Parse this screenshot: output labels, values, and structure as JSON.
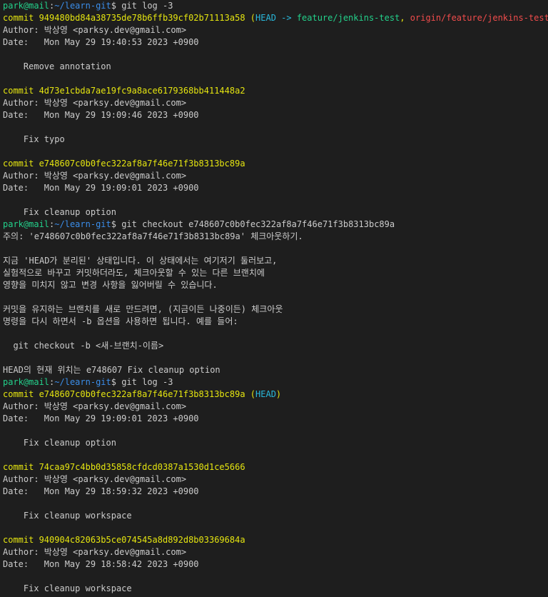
{
  "theme": {
    "background": "#1e1e1e",
    "foreground": "#cccccc",
    "prompt_user": "#23d18b",
    "prompt_path": "#3b8eea",
    "commit": "#e5e510",
    "ref_head": "#29b8db",
    "ref_branch": "#23d18b",
    "ref_remote": "#f14c4c"
  },
  "terminal": {
    "lines": [
      {
        "segments": [
          {
            "text": "park@mail",
            "cls": "prompt-user"
          },
          {
            "text": ":"
          },
          {
            "text": "~/learn-git",
            "cls": "prompt-path"
          },
          {
            "text": "$ git log -3"
          }
        ]
      },
      {
        "segments": [
          {
            "text": "commit 949480bd84a38735de78b6ffb39cf02b71113a58 (",
            "cls": "commit-yellow"
          },
          {
            "text": "HEAD -> ",
            "cls": "ref-head"
          },
          {
            "text": "feature/jenkins-test",
            "cls": "ref-branch"
          },
          {
            "text": ", ",
            "cls": "commit-yellow"
          },
          {
            "text": "origin/feature/jenkins-test",
            "cls": "ref-remote"
          },
          {
            "text": ")",
            "cls": "commit-yellow"
          }
        ]
      },
      {
        "segments": [
          {
            "text": "Author: 박상영 <parksy.dev@gmail.com>"
          }
        ]
      },
      {
        "segments": [
          {
            "text": "Date:   Mon May 29 19:40:53 2023 +0900"
          }
        ]
      },
      {
        "segments": [
          {
            "text": ""
          }
        ]
      },
      {
        "segments": [
          {
            "text": "    Remove annotation"
          }
        ]
      },
      {
        "segments": [
          {
            "text": ""
          }
        ]
      },
      {
        "segments": [
          {
            "text": "commit 4d73e1cbda7ae19fc9a8ace6179368bb411448a2",
            "cls": "commit-yellow"
          }
        ]
      },
      {
        "segments": [
          {
            "text": "Author: 박상영 <parksy.dev@gmail.com>"
          }
        ]
      },
      {
        "segments": [
          {
            "text": "Date:   Mon May 29 19:09:46 2023 +0900"
          }
        ]
      },
      {
        "segments": [
          {
            "text": ""
          }
        ]
      },
      {
        "segments": [
          {
            "text": "    Fix typo"
          }
        ]
      },
      {
        "segments": [
          {
            "text": ""
          }
        ]
      },
      {
        "segments": [
          {
            "text": "commit e748607c0b0fec322af8a7f46e71f3b8313bc89a",
            "cls": "commit-yellow"
          }
        ]
      },
      {
        "segments": [
          {
            "text": "Author: 박상영 <parksy.dev@gmail.com>"
          }
        ]
      },
      {
        "segments": [
          {
            "text": "Date:   Mon May 29 19:09:01 2023 +0900"
          }
        ]
      },
      {
        "segments": [
          {
            "text": ""
          }
        ]
      },
      {
        "segments": [
          {
            "text": "    Fix cleanup option"
          }
        ]
      },
      {
        "segments": [
          {
            "text": "park@mail",
            "cls": "prompt-user"
          },
          {
            "text": ":"
          },
          {
            "text": "~/learn-git",
            "cls": "prompt-path"
          },
          {
            "text": "$ git checkout e748607c0b0fec322af8a7f46e71f3b8313bc89a"
          }
        ]
      },
      {
        "segments": [
          {
            "text": "주의: 'e748607c0b0fec322af8a7f46e71f3b8313bc89a' 체크아웃하기."
          }
        ]
      },
      {
        "segments": [
          {
            "text": ""
          }
        ]
      },
      {
        "segments": [
          {
            "text": "지금 'HEAD가 분리된' 상태입니다. 이 상태에서는 여기저기 둘러보고,"
          }
        ]
      },
      {
        "segments": [
          {
            "text": "실험적으로 바꾸고 커밋하더라도, 체크아웃할 수 있는 다른 브랜치에"
          }
        ]
      },
      {
        "segments": [
          {
            "text": "영향을 미치지 않고 변경 사항을 잃어버릴 수 있습니다."
          }
        ]
      },
      {
        "segments": [
          {
            "text": ""
          }
        ]
      },
      {
        "segments": [
          {
            "text": "커밋을 유지하는 브랜치를 새로 만드려면, (지금이든 나중이든) 체크아웃"
          }
        ]
      },
      {
        "segments": [
          {
            "text": "명령을 다시 하면서 -b 옵션을 사용하면 됩니다. 예를 들어:"
          }
        ]
      },
      {
        "segments": [
          {
            "text": ""
          }
        ]
      },
      {
        "segments": [
          {
            "text": "  git checkout -b <새-브랜치-이름>"
          }
        ]
      },
      {
        "segments": [
          {
            "text": ""
          }
        ]
      },
      {
        "segments": [
          {
            "text": "HEAD의 현재 위치는 e748607 Fix cleanup option"
          }
        ]
      },
      {
        "segments": [
          {
            "text": "park@mail",
            "cls": "prompt-user"
          },
          {
            "text": ":"
          },
          {
            "text": "~/learn-git",
            "cls": "prompt-path"
          },
          {
            "text": "$ git log -3"
          }
        ]
      },
      {
        "segments": [
          {
            "text": "commit e748607c0b0fec322af8a7f46e71f3b8313bc89a (",
            "cls": "commit-yellow"
          },
          {
            "text": "HEAD",
            "cls": "ref-head"
          },
          {
            "text": ")",
            "cls": "commit-yellow"
          }
        ]
      },
      {
        "segments": [
          {
            "text": "Author: 박상영 <parksy.dev@gmail.com>"
          }
        ]
      },
      {
        "segments": [
          {
            "text": "Date:   Mon May 29 19:09:01 2023 +0900"
          }
        ]
      },
      {
        "segments": [
          {
            "text": ""
          }
        ]
      },
      {
        "segments": [
          {
            "text": "    Fix cleanup option"
          }
        ]
      },
      {
        "segments": [
          {
            "text": ""
          }
        ]
      },
      {
        "segments": [
          {
            "text": "commit 74caa97c4bb0d35858cfdcd0387a1530d1ce5666",
            "cls": "commit-yellow"
          }
        ]
      },
      {
        "segments": [
          {
            "text": "Author: 박상영 <parksy.dev@gmail.com>"
          }
        ]
      },
      {
        "segments": [
          {
            "text": "Date:   Mon May 29 18:59:32 2023 +0900"
          }
        ]
      },
      {
        "segments": [
          {
            "text": ""
          }
        ]
      },
      {
        "segments": [
          {
            "text": "    Fix cleanup workspace"
          }
        ]
      },
      {
        "segments": [
          {
            "text": ""
          }
        ]
      },
      {
        "segments": [
          {
            "text": "commit 940904c82063b5ce074545a8d892d8b03369684a",
            "cls": "commit-yellow"
          }
        ]
      },
      {
        "segments": [
          {
            "text": "Author: 박상영 <parksy.dev@gmail.com>"
          }
        ]
      },
      {
        "segments": [
          {
            "text": "Date:   Mon May 29 18:58:42 2023 +0900"
          }
        ]
      },
      {
        "segments": [
          {
            "text": ""
          }
        ]
      },
      {
        "segments": [
          {
            "text": "    Fix cleanup workspace"
          }
        ]
      }
    ]
  }
}
